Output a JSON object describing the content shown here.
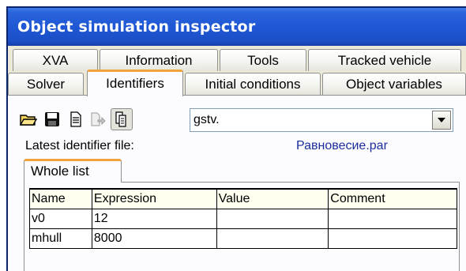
{
  "window": {
    "title": "Object simulation inspector"
  },
  "tabs": {
    "back_row": [
      "XVA",
      "Information",
      "Tools",
      "Tracked vehicle"
    ],
    "front_row": [
      "Solver",
      "Identifiers",
      "Initial conditions",
      "Object variables"
    ],
    "active": "Identifiers"
  },
  "toolbar": {
    "icons": [
      "open-folder-icon",
      "save-icon",
      "document-icon",
      "export-icon",
      "copy-icon"
    ],
    "combo_value": "gstv."
  },
  "latest_file": {
    "label": "Latest identifier file:",
    "value": "Равновесие.par"
  },
  "subtabs": [
    "Whole list"
  ],
  "table": {
    "headers": [
      "Name",
      "Expression",
      "Value",
      "Comment"
    ],
    "rows": [
      [
        "v0",
        "12",
        "",
        ""
      ],
      [
        "mhull",
        "8000",
        "",
        ""
      ]
    ]
  },
  "colors": {
    "title_bar": "#1f57d4",
    "active_tab_accent": "#f0a33a",
    "file_link": "#1a2e9c"
  }
}
